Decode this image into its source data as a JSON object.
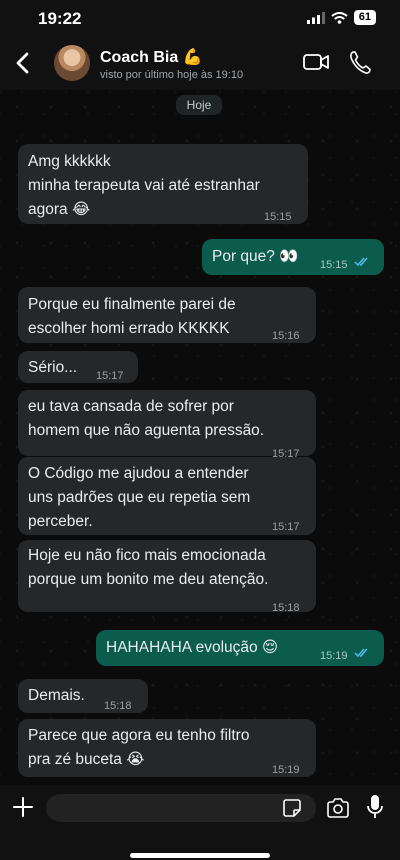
{
  "status_bar": {
    "time": "19:22",
    "battery": "61"
  },
  "header": {
    "contact_name": "Coach Bia 💪",
    "contact_status": "visto por último hoje às 19:10"
  },
  "chat": {
    "day_label": "Hoje",
    "messages": [
      {
        "direction": "in",
        "lines": [
          "Amg kkkkkk",
          "minha terapeuta vai até estranhar",
          "agora 😂"
        ],
        "time": "15:15"
      },
      {
        "direction": "out",
        "lines": [
          "Por que? 👀"
        ],
        "time": "15:15",
        "status": "read"
      },
      {
        "direction": "in",
        "lines": [
          "Porque eu finalmente parei de",
          "escolher homi errado KKKKK"
        ],
        "time": "15:16"
      },
      {
        "direction": "in",
        "lines": [
          "Sério..."
        ],
        "time": "15:17"
      },
      {
        "direction": "in",
        "lines": [
          "eu tava cansada de sofrer por",
          "homem que não aguenta pressão."
        ],
        "time": "15:17"
      },
      {
        "direction": "in",
        "lines": [
          "O Código me ajudou a entender",
          "uns padrões que eu repetia sem",
          "perceber."
        ],
        "time": "15:17"
      },
      {
        "direction": "in",
        "lines": [
          "Hoje eu não fico mais emocionada",
          "porque um bonito me deu atenção."
        ],
        "time": "15:18"
      },
      {
        "direction": "out",
        "lines": [
          "HAHAHAHA evolução 😌"
        ],
        "time": "15:19",
        "status": "read"
      },
      {
        "direction": "in",
        "lines": [
          "Demais."
        ],
        "time": "15:18"
      },
      {
        "direction": "in",
        "lines": [
          "Parece que agora eu tenho filtro",
          "pra zé buceta 😭"
        ],
        "time": "15:19"
      }
    ]
  },
  "input_bar": {
    "placeholder": ""
  },
  "colors": {
    "incoming_bubble": "#252729",
    "outgoing_bubble": "#0b5c4d",
    "read_ticks": "#53bdeb",
    "background": "#0b0b0b"
  }
}
